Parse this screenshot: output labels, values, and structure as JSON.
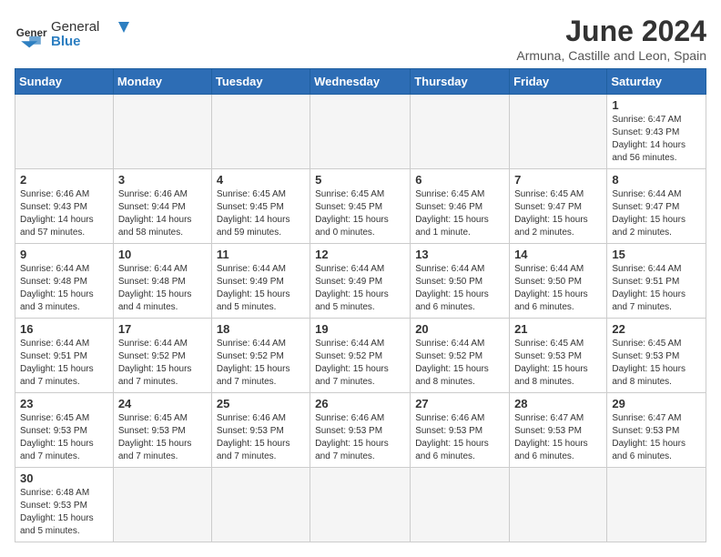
{
  "header": {
    "logo_general": "General",
    "logo_blue": "Blue",
    "title": "June 2024",
    "subtitle": "Armuna, Castille and Leon, Spain"
  },
  "days_of_week": [
    "Sunday",
    "Monday",
    "Tuesday",
    "Wednesday",
    "Thursday",
    "Friday",
    "Saturday"
  ],
  "weeks": [
    [
      {
        "day": null,
        "info": null
      },
      {
        "day": null,
        "info": null
      },
      {
        "day": null,
        "info": null
      },
      {
        "day": null,
        "info": null
      },
      {
        "day": null,
        "info": null
      },
      {
        "day": null,
        "info": null
      },
      {
        "day": "1",
        "info": "Sunrise: 6:47 AM\nSunset: 9:43 PM\nDaylight: 14 hours and 56 minutes."
      }
    ],
    [
      {
        "day": "2",
        "info": "Sunrise: 6:46 AM\nSunset: 9:43 PM\nDaylight: 14 hours and 57 minutes."
      },
      {
        "day": "3",
        "info": "Sunrise: 6:46 AM\nSunset: 9:44 PM\nDaylight: 14 hours and 58 minutes."
      },
      {
        "day": "4",
        "info": "Sunrise: 6:45 AM\nSunset: 9:45 PM\nDaylight: 14 hours and 59 minutes."
      },
      {
        "day": "5",
        "info": "Sunrise: 6:45 AM\nSunset: 9:45 PM\nDaylight: 15 hours and 0 minutes."
      },
      {
        "day": "6",
        "info": "Sunrise: 6:45 AM\nSunset: 9:46 PM\nDaylight: 15 hours and 1 minute."
      },
      {
        "day": "7",
        "info": "Sunrise: 6:45 AM\nSunset: 9:47 PM\nDaylight: 15 hours and 2 minutes."
      },
      {
        "day": "8",
        "info": "Sunrise: 6:44 AM\nSunset: 9:47 PM\nDaylight: 15 hours and 2 minutes."
      }
    ],
    [
      {
        "day": "9",
        "info": "Sunrise: 6:44 AM\nSunset: 9:48 PM\nDaylight: 15 hours and 3 minutes."
      },
      {
        "day": "10",
        "info": "Sunrise: 6:44 AM\nSunset: 9:48 PM\nDaylight: 15 hours and 4 minutes."
      },
      {
        "day": "11",
        "info": "Sunrise: 6:44 AM\nSunset: 9:49 PM\nDaylight: 15 hours and 5 minutes."
      },
      {
        "day": "12",
        "info": "Sunrise: 6:44 AM\nSunset: 9:49 PM\nDaylight: 15 hours and 5 minutes."
      },
      {
        "day": "13",
        "info": "Sunrise: 6:44 AM\nSunset: 9:50 PM\nDaylight: 15 hours and 6 minutes."
      },
      {
        "day": "14",
        "info": "Sunrise: 6:44 AM\nSunset: 9:50 PM\nDaylight: 15 hours and 6 minutes."
      },
      {
        "day": "15",
        "info": "Sunrise: 6:44 AM\nSunset: 9:51 PM\nDaylight: 15 hours and 7 minutes."
      }
    ],
    [
      {
        "day": "16",
        "info": "Sunrise: 6:44 AM\nSunset: 9:51 PM\nDaylight: 15 hours and 7 minutes."
      },
      {
        "day": "17",
        "info": "Sunrise: 6:44 AM\nSunset: 9:52 PM\nDaylight: 15 hours and 7 minutes."
      },
      {
        "day": "18",
        "info": "Sunrise: 6:44 AM\nSunset: 9:52 PM\nDaylight: 15 hours and 7 minutes."
      },
      {
        "day": "19",
        "info": "Sunrise: 6:44 AM\nSunset: 9:52 PM\nDaylight: 15 hours and 7 minutes."
      },
      {
        "day": "20",
        "info": "Sunrise: 6:44 AM\nSunset: 9:52 PM\nDaylight: 15 hours and 8 minutes."
      },
      {
        "day": "21",
        "info": "Sunrise: 6:45 AM\nSunset: 9:53 PM\nDaylight: 15 hours and 8 minutes."
      },
      {
        "day": "22",
        "info": "Sunrise: 6:45 AM\nSunset: 9:53 PM\nDaylight: 15 hours and 8 minutes."
      }
    ],
    [
      {
        "day": "23",
        "info": "Sunrise: 6:45 AM\nSunset: 9:53 PM\nDaylight: 15 hours and 7 minutes."
      },
      {
        "day": "24",
        "info": "Sunrise: 6:45 AM\nSunset: 9:53 PM\nDaylight: 15 hours and 7 minutes."
      },
      {
        "day": "25",
        "info": "Sunrise: 6:46 AM\nSunset: 9:53 PM\nDaylight: 15 hours and 7 minutes."
      },
      {
        "day": "26",
        "info": "Sunrise: 6:46 AM\nSunset: 9:53 PM\nDaylight: 15 hours and 7 minutes."
      },
      {
        "day": "27",
        "info": "Sunrise: 6:46 AM\nSunset: 9:53 PM\nDaylight: 15 hours and 6 minutes."
      },
      {
        "day": "28",
        "info": "Sunrise: 6:47 AM\nSunset: 9:53 PM\nDaylight: 15 hours and 6 minutes."
      },
      {
        "day": "29",
        "info": "Sunrise: 6:47 AM\nSunset: 9:53 PM\nDaylight: 15 hours and 6 minutes."
      }
    ],
    [
      {
        "day": "30",
        "info": "Sunrise: 6:48 AM\nSunset: 9:53 PM\nDaylight: 15 hours and 5 minutes."
      },
      {
        "day": null,
        "info": null
      },
      {
        "day": null,
        "info": null
      },
      {
        "day": null,
        "info": null
      },
      {
        "day": null,
        "info": null
      },
      {
        "day": null,
        "info": null
      },
      {
        "day": null,
        "info": null
      }
    ]
  ]
}
